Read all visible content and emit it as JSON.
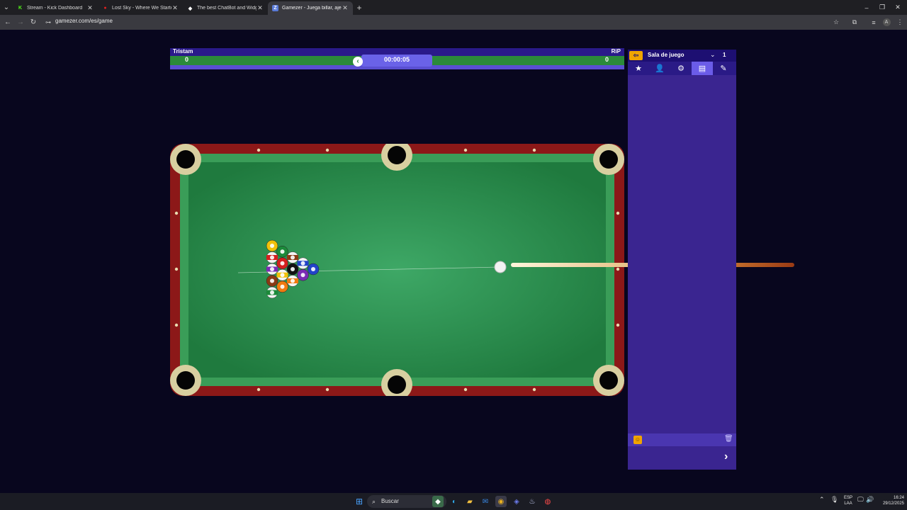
{
  "browser": {
    "tabs": [
      {
        "title": "Stream - Kick Dashboard",
        "favicon": "kick-icon",
        "color": "#53fc18",
        "active": false
      },
      {
        "title": "Lost Sky - Where We Started (f",
        "favicon": "youtube-icon",
        "color": "#e32020",
        "active": false
      },
      {
        "title": "The best ChatBot and Widgets",
        "favicon": "diamond-icon",
        "color": "#ffffff",
        "active": false
      },
      {
        "title": "Gamezer - Juega billar, ajedrez",
        "favicon": "gamezer-icon",
        "color": "#5a7bd8",
        "active": true
      }
    ],
    "new_tab_label": "+",
    "url": "gamezer.com/es/game",
    "window_controls": {
      "minimize": "–",
      "restore": "❐",
      "close": "✕"
    }
  },
  "scoreboard": {
    "player1": {
      "name": "Tristam",
      "score": "0"
    },
    "player2": {
      "name": "RiP",
      "score": "0"
    },
    "timer": "00:00:05",
    "turn_icon": "‹"
  },
  "colors": {
    "felt": "#2f8f55",
    "rail": "#8c1818",
    "cushion": "#3a9d58",
    "panel": "#3a2590",
    "panel_header": "#1d0f72",
    "accent": "#f0a400"
  },
  "balls": [
    {
      "number": 1,
      "color": "#f2c10a",
      "stripe": false
    },
    {
      "number": 2,
      "color": "#2243c8",
      "stripe": false
    },
    {
      "number": 3,
      "color": "#d41f1f",
      "stripe": false
    },
    {
      "number": 4,
      "color": "#7a2bb5",
      "stripe": false
    },
    {
      "number": 5,
      "color": "#f07a10",
      "stripe": false
    },
    {
      "number": 6,
      "color": "#1c8a3a",
      "stripe": false
    },
    {
      "number": 7,
      "color": "#8a3a14",
      "stripe": false
    },
    {
      "number": 8,
      "color": "#111111",
      "stripe": false
    },
    {
      "number": 9,
      "color": "#f2c10a",
      "stripe": true
    },
    {
      "number": 10,
      "color": "#2243c8",
      "stripe": true
    },
    {
      "number": 11,
      "color": "#d41f1f",
      "stripe": true
    },
    {
      "number": 12,
      "color": "#7a2bb5",
      "stripe": true
    },
    {
      "number": 13,
      "color": "#f07a10",
      "stripe": true
    },
    {
      "number": 14,
      "color": "#1c8a3a",
      "stripe": true
    },
    {
      "number": 15,
      "color": "#8a3a14",
      "stripe": true
    }
  ],
  "side_panel": {
    "back_label": "⇦",
    "room_label": "Sala de juego",
    "dropdown_icon": "chevron-down-icon",
    "count": "1",
    "tabs": [
      {
        "name": "favorites",
        "icon": "★"
      },
      {
        "name": "profile",
        "icon": "👤"
      },
      {
        "name": "settings",
        "icon": "⚙"
      },
      {
        "name": "rules",
        "icon": "▤"
      },
      {
        "name": "edit",
        "icon": "✎"
      }
    ],
    "emoji_label": "☺",
    "trash_label": "🗑",
    "next_label": "›"
  },
  "taskbar": {
    "search_placeholder": "Buscar",
    "language": "ESP",
    "keyboard": "LAA",
    "time": "16:24",
    "date": "29/12/2025"
  }
}
